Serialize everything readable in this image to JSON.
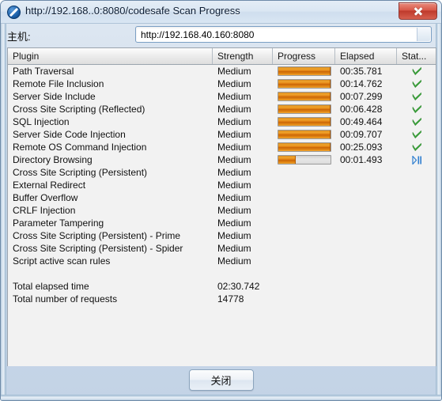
{
  "window": {
    "title": "http://192.168..0:8080/codesafe Scan Progress",
    "icon": "zap-block-icon",
    "close_label": "x"
  },
  "host_bar": {
    "label": "主机:",
    "value": "http://192.168.40.160:8080"
  },
  "table": {
    "columns": [
      "Plugin",
      "Strength",
      "Progress",
      "Elapsed",
      "Stat..."
    ],
    "rows": [
      {
        "plugin": "Path Traversal",
        "strength": "Medium",
        "progress": 100,
        "elapsed": "00:35.781",
        "status": "complete"
      },
      {
        "plugin": "Remote File Inclusion",
        "strength": "Medium",
        "progress": 100,
        "elapsed": "00:14.762",
        "status": "complete"
      },
      {
        "plugin": "Server Side Include",
        "strength": "Medium",
        "progress": 100,
        "elapsed": "00:07.299",
        "status": "complete"
      },
      {
        "plugin": "Cross Site Scripting (Reflected)",
        "strength": "Medium",
        "progress": 100,
        "elapsed": "00:06.428",
        "status": "complete"
      },
      {
        "plugin": "SQL Injection",
        "strength": "Medium",
        "progress": 100,
        "elapsed": "00:49.464",
        "status": "complete"
      },
      {
        "plugin": "Server Side Code Injection",
        "strength": "Medium",
        "progress": 100,
        "elapsed": "00:09.707",
        "status": "complete"
      },
      {
        "plugin": "Remote OS Command Injection",
        "strength": "Medium",
        "progress": 100,
        "elapsed": "00:25.093",
        "status": "complete"
      },
      {
        "plugin": "Directory Browsing",
        "strength": "Medium",
        "progress": 34,
        "elapsed": "00:01.493",
        "status": "running"
      },
      {
        "plugin": "Cross Site Scripting (Persistent)",
        "strength": "Medium",
        "progress": null,
        "elapsed": "",
        "status": "none"
      },
      {
        "plugin": "External Redirect",
        "strength": "Medium",
        "progress": null,
        "elapsed": "",
        "status": "none"
      },
      {
        "plugin": "Buffer Overflow",
        "strength": "Medium",
        "progress": null,
        "elapsed": "",
        "status": "none"
      },
      {
        "plugin": "CRLF Injection",
        "strength": "Medium",
        "progress": null,
        "elapsed": "",
        "status": "none"
      },
      {
        "plugin": "Parameter Tampering",
        "strength": "Medium",
        "progress": null,
        "elapsed": "",
        "status": "none"
      },
      {
        "plugin": "Cross Site Scripting (Persistent) - Prime",
        "strength": "Medium",
        "progress": null,
        "elapsed": "",
        "status": "none"
      },
      {
        "plugin": "Cross Site Scripting (Persistent) - Spider",
        "strength": "Medium",
        "progress": null,
        "elapsed": "",
        "status": "none"
      },
      {
        "plugin": "Script active scan rules",
        "strength": "Medium",
        "progress": null,
        "elapsed": "",
        "status": "none"
      }
    ],
    "summary": [
      {
        "label": "Total elapsed time",
        "value": "02:30.742"
      },
      {
        "label": "Total number of requests",
        "value": "14778"
      }
    ]
  },
  "footer": {
    "close_button": "关闭"
  },
  "colors": {
    "progress_fill": "#e07d10",
    "status_complete": "#3aa93a",
    "status_running": "#2f7fd0",
    "titlebar": "#dbe7f3"
  }
}
